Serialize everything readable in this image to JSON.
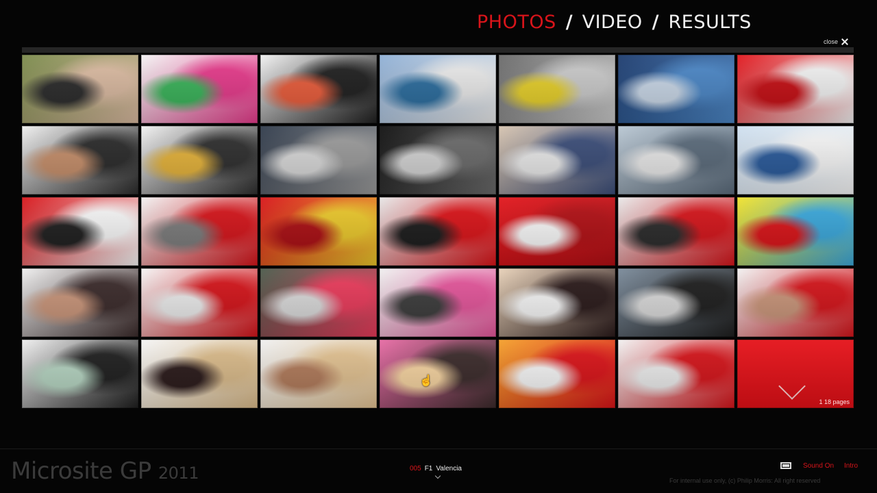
{
  "nav": {
    "photos": "PHOTOS",
    "video": "VIDEO",
    "results": "RESULTS",
    "separator": "/",
    "active": "photos"
  },
  "close_label": "close",
  "gallery": {
    "pager_text": "1  18 pages",
    "thumbnails": [
      {
        "desc": "woman-and-man-portrait",
        "colors": [
          "#7a8a4a",
          "#d9b9a0",
          "#2b2b2b"
        ]
      },
      {
        "desc": "woman-on-colorful-chair",
        "colors": [
          "#f4f4f4",
          "#e43a8a",
          "#3ab35a"
        ]
      },
      {
        "desc": "man-smiling-colorful-sofa",
        "colors": [
          "#f2f2f2",
          "#1f1f1f",
          "#e85c3b"
        ]
      },
      {
        "desc": "white-yacht-harbor",
        "colors": [
          "#8fb0d6",
          "#e9e9e9",
          "#2c6d9e"
        ]
      },
      {
        "desc": "ashtray-on-table",
        "colors": [
          "#6a6a6a",
          "#c9c9c9",
          "#e6cf2a"
        ]
      },
      {
        "desc": "people-silhouettes-window",
        "colors": [
          "#1c3b6e",
          "#4b86c5",
          "#c8d6e6"
        ]
      },
      {
        "desc": "ferrari-red-sign",
        "colors": [
          "#e2151b",
          "#f1f1f1",
          "#c50f15"
        ]
      },
      {
        "desc": "man-profile-portrait",
        "colors": [
          "#f0f0f0",
          "#2a2a2a",
          "#c58e6a"
        ]
      },
      {
        "desc": "man-on-colorful-chair",
        "colors": [
          "#f2f2f2",
          "#2e2e2e",
          "#e4b23a"
        ]
      },
      {
        "desc": "women-walking-stairs",
        "colors": [
          "#2f3a4a",
          "#9a9a9a",
          "#d7d7d7"
        ]
      },
      {
        "desc": "black-white-hair",
        "colors": [
          "#0f0f0f",
          "#6a6a6a",
          "#d2d2d2"
        ]
      },
      {
        "desc": "women-walking-dock",
        "colors": [
          "#d7c4b0",
          "#3b4d78",
          "#e8e8e8"
        ]
      },
      {
        "desc": "women-walking-pier",
        "colors": [
          "#b9c7d3",
          "#5a6a7a",
          "#e7e7e7"
        ]
      },
      {
        "desc": "f1-flags-sky",
        "colors": [
          "#cfe0f0",
          "#f5f5f5",
          "#2a5a9a"
        ]
      },
      {
        "desc": "red-f1-car-display",
        "colors": [
          "#d81318",
          "#f5f5f5",
          "#1e1e1e"
        ]
      },
      {
        "desc": "red-chairs-lounge",
        "colors": [
          "#f2f2f2",
          "#d3141a",
          "#7a7a7a"
        ]
      },
      {
        "desc": "ferrari-logo-car",
        "colors": [
          "#d81318",
          "#e9c62a",
          "#a90e13"
        ]
      },
      {
        "desc": "f1-car-tire",
        "colors": [
          "#e7e7e7",
          "#d81318",
          "#1b1b1b"
        ]
      },
      {
        "desc": "red-fabric",
        "colors": [
          "#e2151b",
          "#b00f14",
          "#f7f7f7"
        ]
      },
      {
        "desc": "three-men-ferrari",
        "colors": [
          "#e9e9e9",
          "#d3141a",
          "#2a2a2a"
        ]
      },
      {
        "desc": "f1-car-pop-art",
        "colors": [
          "#f2e22a",
          "#3aa6d9",
          "#d81318"
        ]
      },
      {
        "desc": "man-closeup-profile",
        "colors": [
          "#f0f0f0",
          "#3a2a2a",
          "#c9957a"
        ]
      },
      {
        "desc": "man-in-simulator",
        "colors": [
          "#f5f5f5",
          "#d3141a",
          "#eaeaea"
        ]
      },
      {
        "desc": "crowd-outdoor",
        "colors": [
          "#4a5a4a",
          "#e83a5a",
          "#d9d9d9"
        ]
      },
      {
        "desc": "woman-meeting-point",
        "colors": [
          "#f0f0f0",
          "#e3559a",
          "#3c3c3c"
        ]
      },
      {
        "desc": "three-women-smiling",
        "colors": [
          "#e9d2b9",
          "#2a1a1a",
          "#f5f5f5"
        ]
      },
      {
        "desc": "crowd-sunglasses",
        "colors": [
          "#7a8a9a",
          "#1e1e1e",
          "#d9d9d9"
        ]
      },
      {
        "desc": "bald-man-ferrari",
        "colors": [
          "#f2f2f2",
          "#d3141a",
          "#c9957a"
        ]
      },
      {
        "desc": "two-women-portrait",
        "colors": [
          "#f0f0f0",
          "#1e1e1e",
          "#b4d3c0"
        ]
      },
      {
        "desc": "blonde-and-brunette",
        "colors": [
          "#f5f5f5",
          "#d8b989",
          "#2a1a1a"
        ]
      },
      {
        "desc": "blonde-woman-closeup",
        "colors": [
          "#f0f0f0",
          "#e0c090",
          "#b07a5a"
        ]
      },
      {
        "desc": "man-pink-background",
        "colors": [
          "#e86aa4",
          "#3a2a2a",
          "#f5d3a0"
        ]
      },
      {
        "desc": "woman-f1-poster",
        "colors": [
          "#f5a02a",
          "#d81318",
          "#f5f5f5"
        ]
      },
      {
        "desc": "red-chair-interior",
        "colors": [
          "#f2f2f2",
          "#d3141a",
          "#ebebeb"
        ]
      }
    ]
  },
  "footer": {
    "brand": "Microsite GP",
    "year": "2011",
    "race_number": "005",
    "race_series": "F1",
    "race_name": "Valencia",
    "sound_label": "Sound On",
    "intro_label": "Intro",
    "copyright": "For internal use only, (c) Philip Morris: All right reserved"
  }
}
